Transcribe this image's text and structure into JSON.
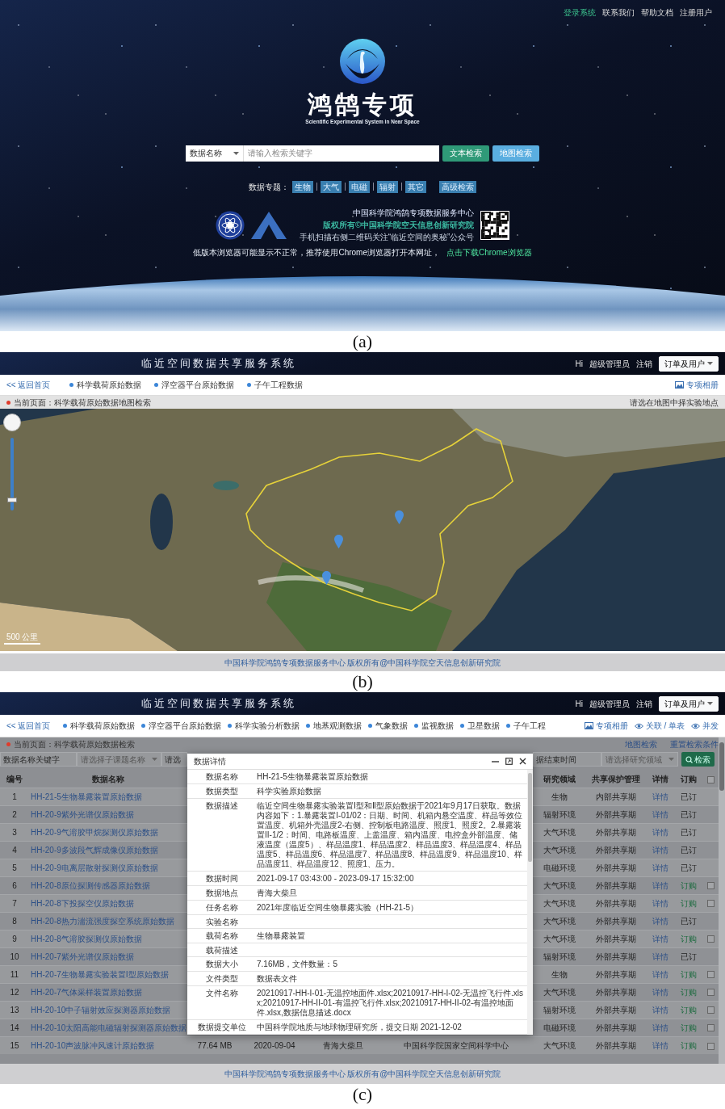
{
  "portal": {
    "top_links": [
      {
        "label": "登录系统",
        "highlighted": true
      },
      {
        "label": "联系我们",
        "highlighted": false
      },
      {
        "label": "帮助文档",
        "highlighted": false
      },
      {
        "label": "注册用户",
        "highlighted": false
      }
    ],
    "logo": {
      "title": "鸿鹄专项",
      "subtitle": "Scientific Experimental System in Near Space"
    },
    "search": {
      "select": "数据名称",
      "placeholder": "请输入检索关键字",
      "buttons": [
        {
          "label": "文本检索",
          "kind": "text"
        },
        {
          "label": "地图检索",
          "kind": "map"
        }
      ]
    },
    "topics": {
      "label": "数据专题：",
      "tags": [
        "生物",
        "大气",
        "电磁",
        "辐射",
        "其它"
      ],
      "advanced": "高级检索"
    },
    "footer": {
      "lines": [
        {
          "text": "中国科学院鸿鹄专项数据服务中心",
          "kind": "plain"
        },
        {
          "text": "版权所有©中国科学院空天信息创新研究院",
          "kind": "strong"
        },
        {
          "text": "手机扫描右侧二维码关注“临近空间的奥秘”公众号",
          "kind": "small"
        }
      ],
      "notice": "低版本浏览器可能显示不正常，推荐使用Chrome浏览器打开本网址，",
      "download": "点击下载Chrome浏览器"
    },
    "caption": "(a)"
  },
  "map_search": {
    "header": {
      "title": "临近空间数据共享服务系统",
      "greeting": "Hi",
      "user": "超级管理员",
      "logout": "注销",
      "menu": "订单及用户"
    },
    "nav": {
      "back": "<< 返回首页",
      "items": [
        "科学载荷原始数据",
        "浮空器平台原始数据",
        "子午工程数据"
      ],
      "right_links": [
        {
          "label": "专项相册"
        }
      ]
    },
    "breadcrumb": {
      "text": "当前页面：科学载荷原始数据地图检索",
      "hint": "请选在地图中择实验地点"
    },
    "map": {
      "zoom": {
        "level": 0.12
      },
      "scale": "500 公里"
    },
    "footer": "中国科学院鸿鹄专项数据服务中心 版权所有@中国科学院空天信息创新研究院",
    "caption": "(b)"
  },
  "data_search": {
    "header": {
      "title": "临近空间数据共享服务系统",
      "greeting": "Hi",
      "user": "超级管理员",
      "logout": "注销",
      "menu": "订单及用户"
    },
    "nav": {
      "back": "<< 返回首页",
      "items": [
        "科学载荷原始数据",
        "浮空器平台原始数据",
        "科学实验分析数据",
        "地基观测数据",
        "气象数据",
        "监视数据",
        "卫星数据",
        "子午工程"
      ],
      "right_links": [
        {
          "label": "专项相册"
        },
        {
          "label": "关联 / 单表"
        },
        {
          "label": "并发"
        }
      ]
    },
    "breadcrumb": {
      "text": "当前页面：科学载荷原始数据检索",
      "links": [
        "地图检索",
        "重置检索条件"
      ]
    },
    "filters_left": [
      {
        "kind": "input",
        "placeholder": "数据名称关键字"
      },
      {
        "kind": "select",
        "placeholder": "请选择子课题名称"
      },
      {
        "kind": "input",
        "placeholder": "请选"
      }
    ],
    "filters_right": [
      {
        "kind": "input",
        "placeholder": "据结束时间"
      },
      {
        "kind": "select",
        "placeholder": "请选择研究领域"
      }
    ],
    "search_button": "检索",
    "table": {
      "columns": [
        "编号",
        "数据名称",
        "研究领域",
        "共享保护管理",
        "详情",
        "订购"
      ],
      "select_all": {
        "checked": false
      },
      "rows": [
        {
          "no": "1",
          "name": "HH-21-5生物暴露装置原始数据",
          "field": "生物",
          "sharing": "内部共享期",
          "detail": "详情",
          "order": "已订",
          "ordered": true
        },
        {
          "no": "2",
          "name": "HH-20-9紫外光谱仪原始数据",
          "field": "辐射环境",
          "sharing": "外部共享期",
          "detail": "详情",
          "order": "已订",
          "ordered": true
        },
        {
          "no": "3",
          "name": "HH-20-9气溶胶甲烷探测仪原始数据",
          "field": "大气环境",
          "sharing": "外部共享期",
          "detail": "详情",
          "order": "已订",
          "ordered": true
        },
        {
          "no": "4",
          "name": "HH-20-9多波段气辉成像仪原始数据",
          "field": "大气环境",
          "sharing": "外部共享期",
          "detail": "详情",
          "order": "已订",
          "ordered": true
        },
        {
          "no": "5",
          "name": "HH-20-9电离层散射探测仪原始数据",
          "field": "电磁环境",
          "sharing": "外部共享期",
          "detail": "详情",
          "order": "已订",
          "ordered": true
        },
        {
          "no": "6",
          "name": "HH-20-8原位探测传感器原始数据",
          "field": "大气环境",
          "sharing": "外部共享期",
          "detail": "详情",
          "order": "订购",
          "ordered": false,
          "checked": false
        },
        {
          "no": "7",
          "name": "HH-20-8下投探空仪原始数据",
          "field": "大气环境",
          "sharing": "外部共享期",
          "detail": "详情",
          "order": "订购",
          "ordered": false,
          "checked": false
        },
        {
          "no": "8",
          "name": "HH-20-8热力湍流强度探空系统原始数据",
          "field": "大气环境",
          "sharing": "外部共享期",
          "detail": "详情",
          "order": "已订",
          "ordered": true
        },
        {
          "no": "9",
          "name": "HH-20-8气溶胶探测仪原始数据",
          "field": "大气环境",
          "sharing": "外部共享期",
          "detail": "详情",
          "order": "订购",
          "ordered": false,
          "checked": false
        },
        {
          "no": "10",
          "name": "HH-20-7紫外光谱仪原始数据",
          "field": "辐射环境",
          "sharing": "外部共享期",
          "detail": "详情",
          "order": "已订",
          "ordered": true
        },
        {
          "no": "11",
          "name": "HH-20-7生物暴露实验装置Ⅰ型原始数据",
          "field": "生物",
          "sharing": "外部共享期",
          "detail": "详情",
          "order": "订购",
          "ordered": false,
          "checked": false
        },
        {
          "no": "12",
          "name": "HH-20-7气体采样装置原始数据",
          "field": "大气环境",
          "sharing": "外部共享期",
          "detail": "详情",
          "order": "订购",
          "ordered": false,
          "checked": false
        },
        {
          "no": "13",
          "name": "HH-20-10中子辐射效应探测器原始数据",
          "field": "辐射环境",
          "sharing": "外部共享期",
          "detail": "详情",
          "order": "订购",
          "ordered": false,
          "checked": false
        },
        {
          "no": "14",
          "name": "HH-20-10太阳高能电磁辐射探测器原始数据",
          "field": "电磁环境",
          "sharing": "外部共享期",
          "detail": "详情",
          "order": "订购",
          "ordered": false,
          "checked": false
        },
        {
          "no": "15",
          "name": "HH-20-10声波脉冲风速计原始数据",
          "size": "77.64 MB",
          "date": "2020-09-04",
          "place": "青海大柴旦",
          "unit": "中国科学院国家空间科学中心",
          "field": "大气环境",
          "sharing": "外部共享期",
          "detail": "详情",
          "order": "订购",
          "ordered": false,
          "checked": false
        }
      ]
    },
    "modal": {
      "title": "数据详情",
      "fields": [
        {
          "label": "数据名称",
          "value": "HH-21-5生物暴露装置原始数据"
        },
        {
          "label": "数据类型",
          "value": "科学实验原始数据"
        },
        {
          "label": "数据描述",
          "value": "临近空间生物暴露实验装置Ⅰ型和Ⅱ型原始数据于2021年9月17日获取。数据内容如下：1.暴露装置I-01/02：日期、时间、机箱内悬空温度、样品等效位置温度、机箱外壳温度2-右侧、控制板电路温度、照度1、照度2。2.暴露装置II-1/2：时间、电路板温度、上盖温度、箱内温度、电控盒外部温度、储液温度（温度5）、样品温度1、样品温度2、样品温度3、样品温度4、样品温度5、样品温度6、样品温度7、样品温度8、样品温度9、样品温度10、样品温度11、样品温度12、照度1、压力。"
        },
        {
          "label": "数据时间",
          "value": "2021-09-17 03:43:00 - 2023-09-17 15:32:00"
        },
        {
          "label": "数据地点",
          "value": "青海大柴旦"
        },
        {
          "label": "任务名称",
          "value": "2021年度临近空间生物暴露实验（HH-21-5）"
        },
        {
          "label": "实验名称"
        },
        {
          "label": "载荷名称",
          "value": "生物暴露装置"
        },
        {
          "label": "载荷描述"
        },
        {
          "label": "数据大小",
          "value": "7.16MB，文件数量：5"
        },
        {
          "label": "文件类型",
          "value": "数据表文件"
        },
        {
          "label": "文件名称",
          "value": "20210917-HH-I-01-无温控地面件.xlsx;20210917-HH-I-02-无温控飞行件.xlsx;20210917-HH-II-01-有温控飞行件.xlsx;20210917-HH-II-02-有温控地面件.xlsx,数据信息描述.docx"
        },
        {
          "label": "数据提交单位",
          "value": "中国科学院地质与地球物理研究所，提交日期 2021-12-02"
        }
      ]
    },
    "footer": "中国科学院鸿鹄专项数据服务中心 版权所有@中国科学院空天信息创新研究院",
    "caption": "(c)"
  }
}
